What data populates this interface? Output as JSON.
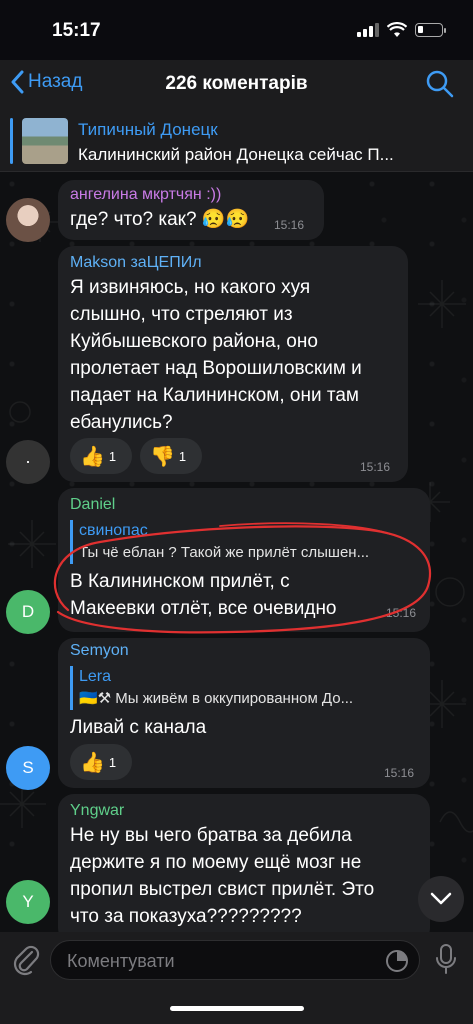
{
  "status_bar": {
    "time": "15:17",
    "battery_level": 0.25
  },
  "nav": {
    "back_label": "Назад",
    "title": "226 коментарів"
  },
  "channel": {
    "name": "Типичный Донецк",
    "preview": "Калининский район Донецка сейчас  П..."
  },
  "messages": [
    {
      "sender": "ангелина мкртчян :))",
      "sender_color": "#c97be6",
      "text": "где? что? как? 😥😥",
      "time": "15:16"
    },
    {
      "sender": "Makson заЦЕПИл",
      "sender_color": "#5fb1f6",
      "lines": [
        "Я извиняюсь, но какого хуя",
        "слышно, что стреляют из",
        "Куйбышевского района, оно",
        "пролетает над Ворошиловским и",
        "падает на Калининском, они там",
        "ебанулись?"
      ],
      "reactions": [
        {
          "emoji": "👍",
          "count": "1"
        },
        {
          "emoji": "👎",
          "count": "1"
        }
      ],
      "time": "15:16"
    },
    {
      "sender": "Daniel",
      "sender_color": "#5fcf8a",
      "avatar_letter": "D",
      "avatar_color": "#4ab86a",
      "reply_name": "свинопас",
      "reply_text": "Ты чё еблан ? Такой же прилёт слышен...",
      "lines": [
        "В Калининском прилёт, с",
        "Макеевки отлёт, все очевидно"
      ],
      "time": "15:16"
    },
    {
      "sender": "Semyon",
      "sender_color": "#5fb1f6",
      "avatar_letter": "S",
      "avatar_color": "#3e9bf4",
      "reply_name": "Lera",
      "reply_text": "🇺🇦⚒ Мы живём в оккупированном До...",
      "lines": [
        "Ливай с канала"
      ],
      "reactions": [
        {
          "emoji": "👍",
          "count": "1"
        }
      ],
      "time": "15:16"
    },
    {
      "sender": "Yngwar",
      "sender_color": "#5fcf8a",
      "avatar_letter": "Y",
      "avatar_color": "#4ab86a",
      "lines": [
        "Не ну вы чего братва за дебила",
        "держите я по моему ещё мозг не",
        "пропил выстрел свист прилёт. Это",
        "что за показуха?????????"
      ]
    }
  ],
  "input": {
    "placeholder": "Коментувати"
  },
  "colors": {
    "accent": "#3e9bf4",
    "bubble": "#1f2023",
    "annotation": "#e03030"
  }
}
